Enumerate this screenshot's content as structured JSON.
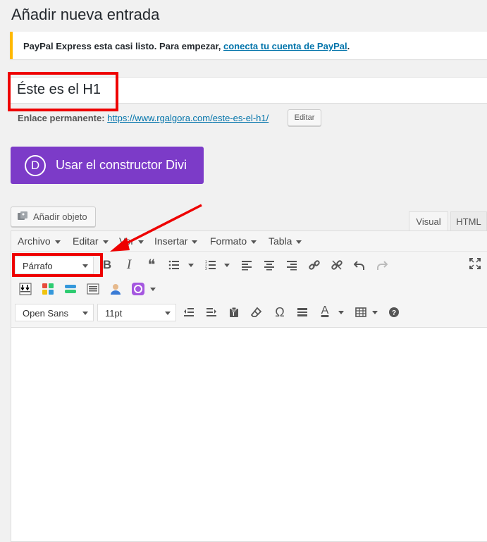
{
  "page": {
    "title": "Añadir nueva entrada"
  },
  "notice": {
    "text": "PayPal Express esta casi listo. Para empezar, ",
    "link": "conecta tu cuenta de PayPal",
    "tail": "."
  },
  "post": {
    "title": "Éste es el H1",
    "permalink_label": "Enlace permanente:",
    "permalink_base": "https://www.rgalgora.com/",
    "permalink_slug": "este-es-el-h1",
    "permalink_end": "/",
    "edit_label": "Editar"
  },
  "divi": {
    "label": "Usar el constructor Divi",
    "logo_letter": "D"
  },
  "media": {
    "add_label": "Añadir objeto"
  },
  "tabs": {
    "visual": "Visual",
    "html": "HTML"
  },
  "menubar": [
    "Archivo",
    "Editar",
    "Ver",
    "Insertar",
    "Formato",
    "Tabla"
  ],
  "toolbar": {
    "format_select": "Párrafo",
    "font_select": "Open Sans",
    "size_select": "11pt",
    "bold_glyph": "B",
    "italic_glyph": "I",
    "quote_glyph": "❝",
    "omega_glyph": "Ω",
    "textcolor_glyph": "A",
    "help_glyph": "?"
  },
  "colors": {
    "divi": "#7c3bc8",
    "link": "#0073aa",
    "highlight": "#e00000",
    "notice_border": "#ffb900"
  }
}
